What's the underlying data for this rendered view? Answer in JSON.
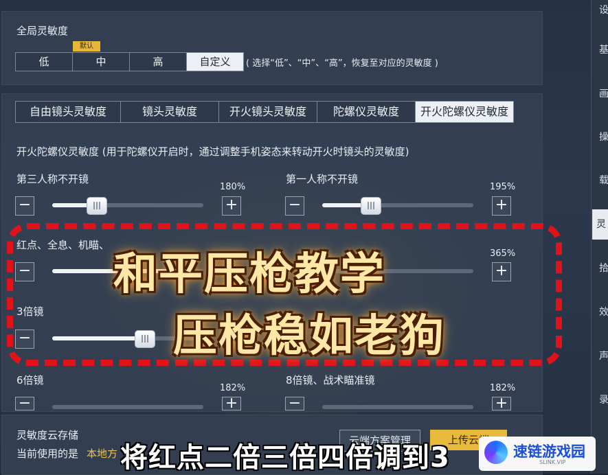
{
  "global": {
    "title": "全局灵敏度",
    "badge": "默认",
    "options": [
      "低",
      "中",
      "高",
      "自定义"
    ],
    "active": "自定义",
    "hint": "( 选择“低”、“中”、“高”，恢复至对应的灵敏度 )"
  },
  "tabs": [
    "自由镜头灵敏度",
    "镜头灵敏度",
    "开火镜头灵敏度",
    "陀螺仪灵敏度",
    "开火陀螺仪灵敏度"
  ],
  "active_tab": "开火陀螺仪灵敏度",
  "section": {
    "description": "开火陀螺仪灵敏度 (用于陀螺仪开启时，通过调整手机姿态来转动开火时镜头的灵敏度)"
  },
  "sliders": [
    {
      "label": "第三人称不开镜",
      "value": 180,
      "value_text": "180%"
    },
    {
      "label": "第一人称不开镜",
      "value": 195,
      "value_text": "195%"
    },
    {
      "label": "红点、全息、机瞄、",
      "value": null,
      "value_text": ""
    },
    {
      "label": "",
      "value": 365,
      "value_text": "365%"
    },
    {
      "label": "3倍镜",
      "value": null,
      "value_text": ""
    },
    {
      "label": "6倍镜",
      "value": 182,
      "value_text": "182%"
    },
    {
      "label": "8倍镜、战术瞄准镜",
      "value": 182,
      "value_text": "182%"
    }
  ],
  "slider_range": [
    0,
    400
  ],
  "minus": "−",
  "plus": "+",
  "cloud": {
    "title": "灵敏度云存储",
    "current_prefix": "当前使用的是",
    "current_value": "本地方",
    "manage_btn": "云端方案管理",
    "upload_btn": "上传云端"
  },
  "overlay": {
    "line1": "和平压枪教学",
    "line2": "压枪稳如老狗",
    "subtitle": "将红点二倍三倍四倍调到3"
  },
  "right_nav": [
    "设",
    "基",
    "画",
    "操",
    "载",
    "灵敏",
    "拾",
    "效",
    "声",
    "录"
  ],
  "watermark": {
    "name": "速链游戏园",
    "sub": "SLINK.VIP"
  },
  "colors": {
    "accent_red": "#e0131b",
    "overlay_gold": "#ffe7a6"
  }
}
